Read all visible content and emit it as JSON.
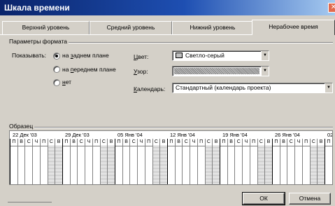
{
  "window": {
    "title": "Шкала времени"
  },
  "tabs": [
    {
      "label": "Верхний уровень"
    },
    {
      "label": "Средний уровень"
    },
    {
      "label": "Нижний уровень"
    },
    {
      "label": "Нерабочее время"
    }
  ],
  "format_params": {
    "group_label": "Параметры формата",
    "show_label": "Показывать:",
    "options": [
      {
        "mnemonic": "з",
        "rest": "аднем плане",
        "prefix": "на ",
        "checked": true
      },
      {
        "mnemonic": "п",
        "rest": "ереднем плане",
        "prefix": "на ",
        "checked": false
      },
      {
        "mnemonic": "н",
        "rest": "ет",
        "prefix": "",
        "checked": false
      }
    ],
    "color_label_mn": "Ц",
    "color_label_rest": "вет:",
    "color_value": "Светло-серый",
    "color_swatch": "#c0c0c0",
    "pattern_label_mn": "У",
    "pattern_label_rest": "зор:",
    "calendar_label_mn": "К",
    "calendar_label_rest": "алендарь:",
    "calendar_value": "Стандартный (календарь проекта)"
  },
  "sample": {
    "group_label": "Образец",
    "weeks": [
      "22 Дек '03",
      "29 Дек '03",
      "05 Янв '04",
      "12 Янв '04",
      "19 Янв '04",
      "26 Янв '04",
      "02"
    ],
    "days": [
      "П",
      "В",
      "С",
      "Ч",
      "П",
      "С",
      "В"
    ]
  },
  "buttons": {
    "ok": "ОК",
    "cancel": "Отмена"
  }
}
